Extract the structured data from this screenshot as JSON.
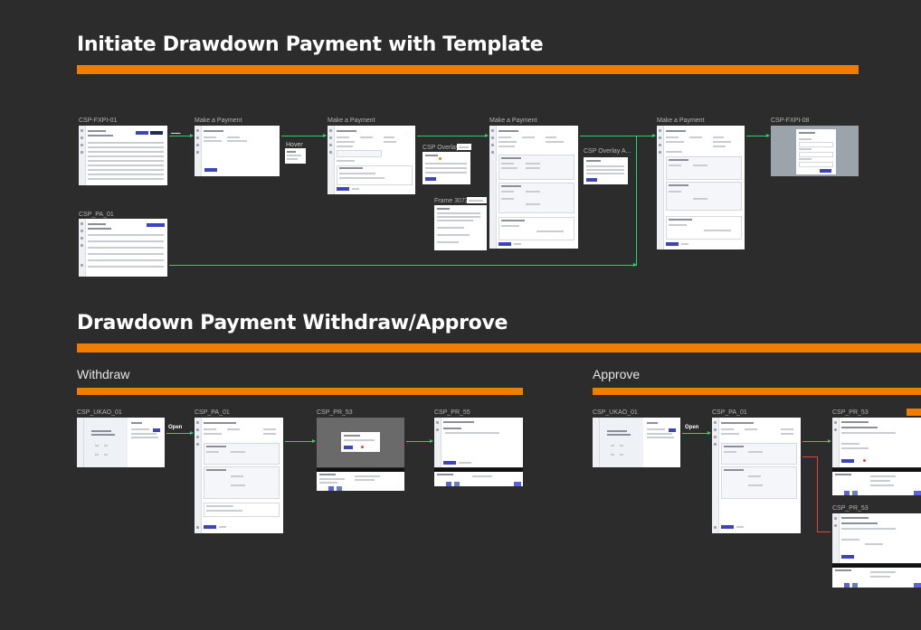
{
  "section1": {
    "title": "Initiate Drawdown Payment with Template"
  },
  "section2": {
    "title": "Drawdown Payment Withdraw/Approve",
    "withdraw": "Withdraw",
    "approve": "Approve"
  },
  "frames": {
    "fxpi01": "CSP-FXPI-01",
    "mp1": "Make a Payment",
    "hover": "Hover",
    "mp2": "Make a Payment",
    "overlay1": "CSP Overlay",
    "frame3072": "Frame 3072",
    "mp3": "Make a Payment",
    "overlay2": "CSP Overlay A...",
    "mp4": "Make a Payment",
    "fxpi08": "CSP-FXPI-08",
    "pa01_top": "CSP_PA_01",
    "w_ukao": "CSP_UKAO_01",
    "w_pa01": "CSP_PA_01",
    "w_pr53": "CSP_PR_53",
    "w_pr55": "CSP_PR_55",
    "a_ukao": "CSP_UKAO_01",
    "a_pa01": "CSP_PA_01",
    "a_pr53_top": "CSP_PR_53",
    "a_pr53_bottom": "CSP_PR_53"
  },
  "arrows": {
    "open1": "Open",
    "open2": "Open"
  },
  "colors": {
    "background": "#2c2c2c",
    "accent": "#f07d00",
    "connector": "#27d36b",
    "reject_connector": "#e0453a",
    "primary_button": "#3d45b8"
  }
}
